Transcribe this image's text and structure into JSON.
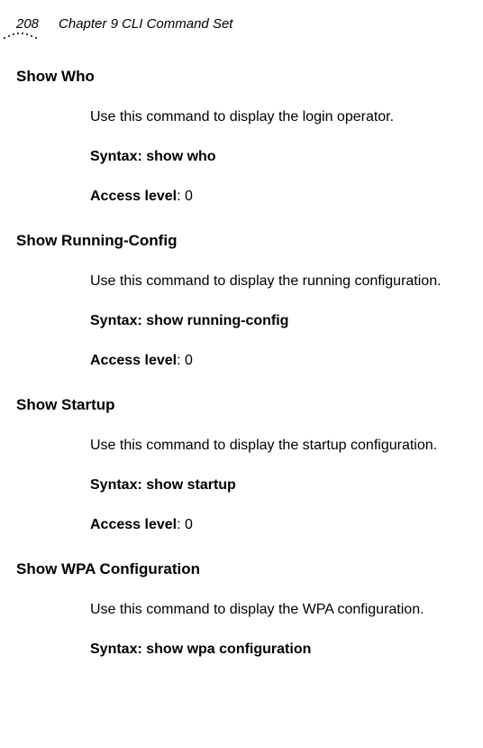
{
  "header": {
    "page_number": "208",
    "chapter_title": "Chapter 9 CLI Command Set"
  },
  "sections": {
    "show_who": {
      "heading": "Show Who",
      "description": "Use this command to display the login operator.",
      "syntax_label": "Syntax: ",
      "syntax_value": "show who",
      "access_label": "Access level",
      "access_value": ": 0"
    },
    "show_running_config": {
      "heading": "Show Running-Config",
      "description": "Use this command to display the running configuration.",
      "syntax_label": "Syntax: ",
      "syntax_value": "show running-config",
      "access_label": "Access level",
      "access_value": ": 0"
    },
    "show_startup": {
      "heading": "Show Startup",
      "description": "Use this command to display the startup configuration.",
      "syntax_label": "Syntax: ",
      "syntax_value": "show startup",
      "access_label": "Access level",
      "access_value": ": 0"
    },
    "show_wpa": {
      "heading": "Show WPA Configuration",
      "description": "Use this command to display the WPA configuration.",
      "syntax_label": "Syntax: ",
      "syntax_value": "show wpa configuration"
    }
  }
}
